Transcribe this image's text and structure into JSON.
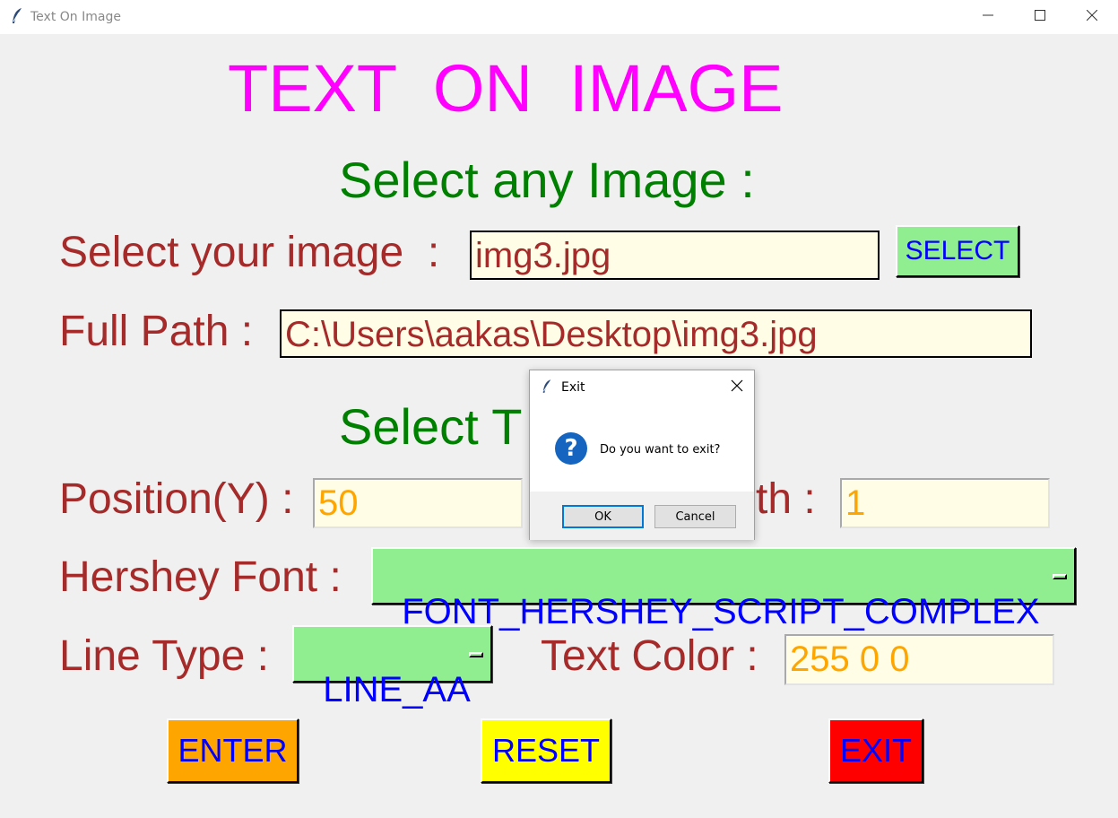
{
  "window": {
    "title": "Text On Image",
    "icon": "feather-icon",
    "controls": [
      "minimize-icon",
      "maximize-icon",
      "close-icon"
    ]
  },
  "app": {
    "title": "TEXT  ON  IMAGE",
    "section_image": "Select any Image :",
    "section_text": "Select T",
    "select_image_label": "Select your image  :",
    "select_image_value": "img3.jpg",
    "select_button": "SELECT",
    "full_path_label": "Full Path :",
    "full_path_value": "C:\\Users\\aakas\\Desktop\\img3.jpg",
    "position_y_label": "Position(Y) :",
    "position_y_value": "50",
    "thickness_label_partial": "th :",
    "thickness_value": "1",
    "hershey_font_label": "Hershey Font :",
    "hershey_font_value": "FONT_HERSHEY_SCRIPT_COMPLEX",
    "line_type_label": "Line Type :",
    "line_type_value": "LINE_AA",
    "text_color_label": "Text Color :",
    "text_color_value": "255 0 0",
    "enter_button": "ENTER",
    "reset_button": "RESET",
    "exit_button": "EXIT"
  },
  "dialog": {
    "title": "Exit",
    "icon": "question-icon",
    "message": "Do you want to exit?",
    "ok_label": "OK",
    "cancel_label": "Cancel"
  },
  "colors": {
    "title": "#ff00ff",
    "section": "#008000",
    "label": "#a52a2a",
    "entry_bg": "#fffde5",
    "button_text": "#0000ff",
    "select_bg": "#90ee90",
    "enter_bg": "#ffa500",
    "reset_bg": "#ffff00",
    "exit_bg": "#ff0000"
  }
}
